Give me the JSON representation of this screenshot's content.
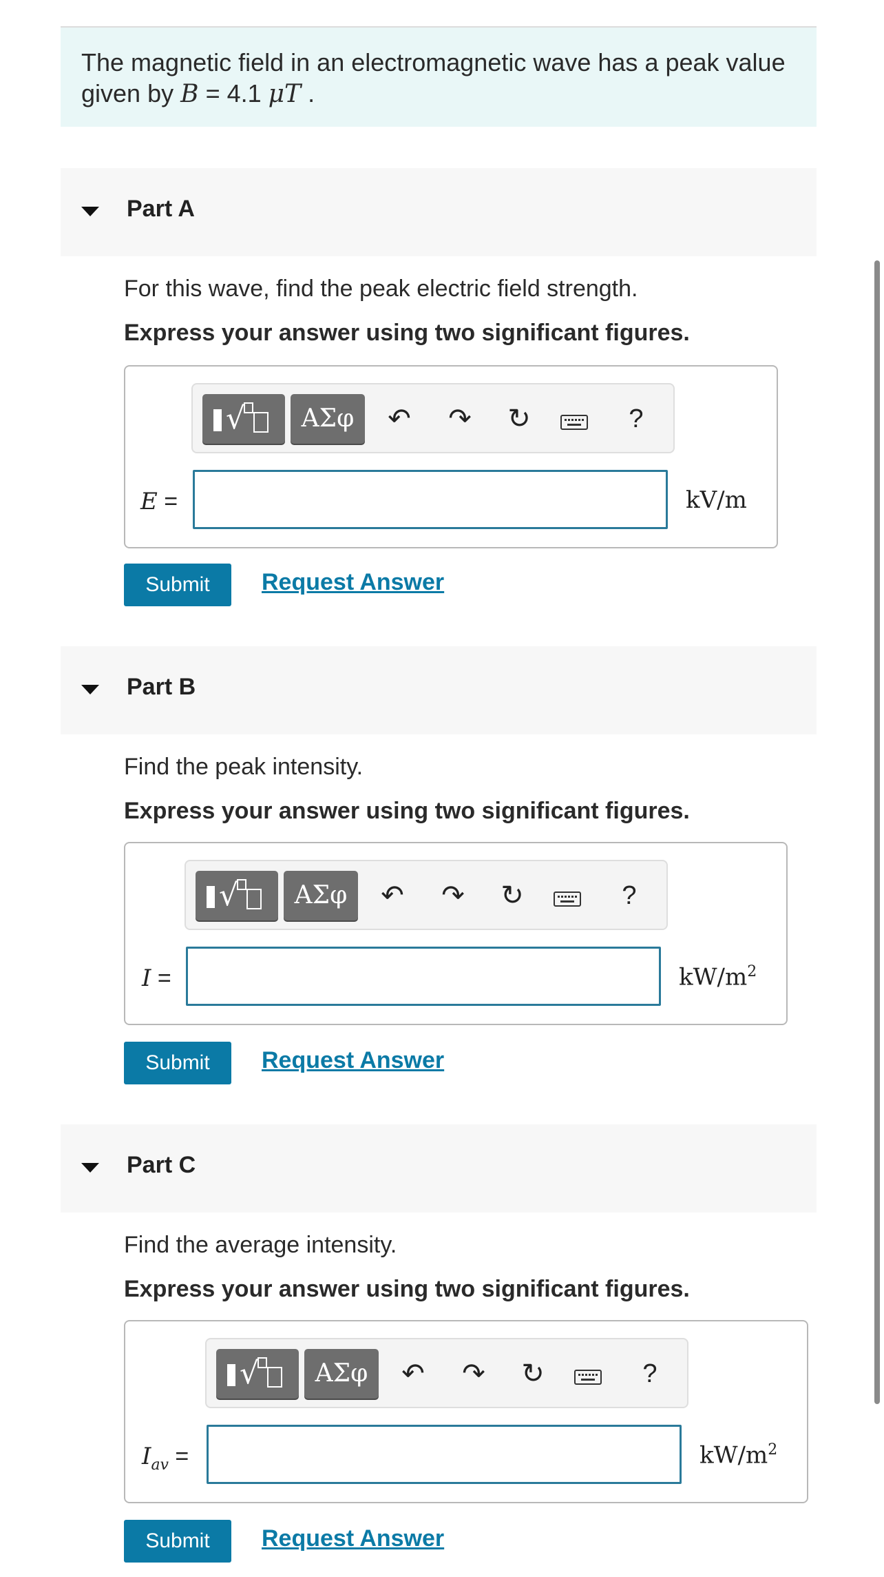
{
  "intro": {
    "text_prefix": "The magnetic field in an electromagnetic wave has a peak value given by ",
    "var": "B",
    "equals": " = 4.1 ",
    "unit": "μT",
    "text_suffix": " ."
  },
  "parts": [
    {
      "label": "Part A",
      "question": "For this wave, find the peak electric field strength.",
      "instruction": "Express your answer using two significant figures.",
      "var": "E",
      "var_sub": "",
      "equals": " =",
      "unit": "kV/m",
      "unit_sup": "",
      "input_value": "",
      "submit_label": "Submit",
      "request_label": "Request Answer"
    },
    {
      "label": "Part B",
      "question": "Find the peak intensity.",
      "instruction": "Express your answer using two significant figures.",
      "var": "I",
      "var_sub": "",
      "equals": " =",
      "unit": "kW/m",
      "unit_sup": "2",
      "input_value": "",
      "submit_label": "Submit",
      "request_label": "Request Answer"
    },
    {
      "label": "Part C",
      "question": "Find the average intensity.",
      "instruction": "Express your answer using two significant figures.",
      "var": "I",
      "var_sub": "av",
      "equals": " =",
      "unit": "kW/m",
      "unit_sup": "2",
      "input_value": "",
      "submit_label": "Submit",
      "request_label": "Request Answer"
    }
  ],
  "toolbar": {
    "greek_label": "ΑΣφ",
    "undo_icon": "↶",
    "redo_icon": "↷",
    "reset_icon": "↻",
    "help_label": "?"
  }
}
